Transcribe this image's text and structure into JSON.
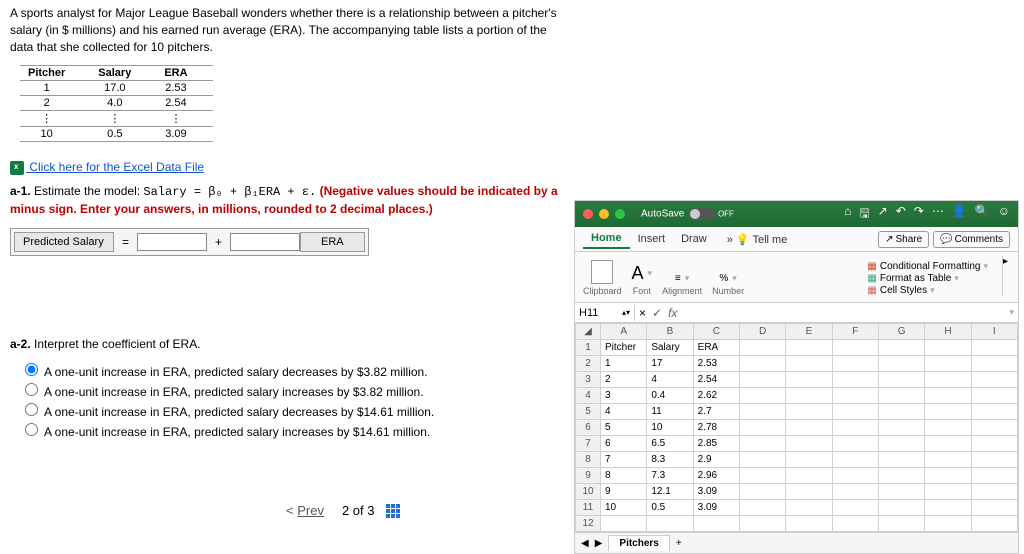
{
  "question": {
    "intro": "A sports analyst for Major League Baseball wonders whether there is a relationship between a pitcher's salary (in $ millions) and his earned run average (ERA). The accompanying table lists a portion of the data that she collected for 10 pitchers.",
    "sampleTable": {
      "headers": [
        "Pitcher",
        "Salary",
        "ERA"
      ],
      "rows": [
        [
          "1",
          "17.0",
          "2.53"
        ],
        [
          "2",
          "4.0",
          "2.54"
        ],
        [
          "⋮",
          "⋮",
          "⋮"
        ],
        [
          "10",
          "0.5",
          "3.09"
        ]
      ]
    },
    "fileLink": "Click here for the Excel Data File",
    "a1_prefix": "a-1.",
    "a1_text": " Estimate the model: ",
    "a1_model": "Salary = β₀ + β₁ERA + ε.",
    "a1_red": " (Negative values should be indicated by a minus sign. Enter your answers, in millions, rounded to 2 decimal places.)",
    "predicted_label": "Predicted Salary",
    "eq": "=",
    "plus": "+",
    "era": "ERA",
    "a2_prefix": "a-2.",
    "a2_text": " Interpret the coefficient of ERA.",
    "options": [
      "A one-unit increase in ERA, predicted salary decreases by $3.82 million.",
      "A one-unit increase in ERA, predicted salary increases by $3.82 million.",
      "A one-unit increase in ERA, predicted salary decreases by $14.61 million.",
      "A one-unit increase in ERA, predicted salary increases by $14.61 million."
    ]
  },
  "pager": {
    "prev": "Prev",
    "pos": "2 of 3"
  },
  "excel": {
    "autosave": "AutoSave",
    "autosave_state": "OFF",
    "tabs": {
      "home": "Home",
      "insert": "Insert",
      "draw": "Draw",
      "tellme": "Tell me"
    },
    "share": "Share",
    "comments": "Comments",
    "groups": {
      "clipboard": "Clipboard",
      "font": "Font",
      "alignment": "Alignment",
      "number": "Number"
    },
    "cmds": {
      "cf": "Conditional Formatting",
      "ft": "Format as Table",
      "cs": "Cell Styles"
    },
    "namebox": "H11",
    "columns": [
      "A",
      "B",
      "C",
      "D",
      "E",
      "F",
      "G",
      "H",
      "I"
    ],
    "data": {
      "headers": [
        "Pitcher",
        "Salary",
        "ERA"
      ],
      "rows": [
        [
          "1",
          "17",
          "2.53"
        ],
        [
          "2",
          "4",
          "2.54"
        ],
        [
          "3",
          "0.4",
          "2.62"
        ],
        [
          "4",
          "11",
          "2.7"
        ],
        [
          "5",
          "10",
          "2.78"
        ],
        [
          "6",
          "6.5",
          "2.85"
        ],
        [
          "7",
          "8.3",
          "2.9"
        ],
        [
          "8",
          "7.3",
          "2.96"
        ],
        [
          "9",
          "12.1",
          "3.09"
        ],
        [
          "10",
          "0.5",
          "3.09"
        ]
      ]
    },
    "sheet": "Pitchers"
  }
}
